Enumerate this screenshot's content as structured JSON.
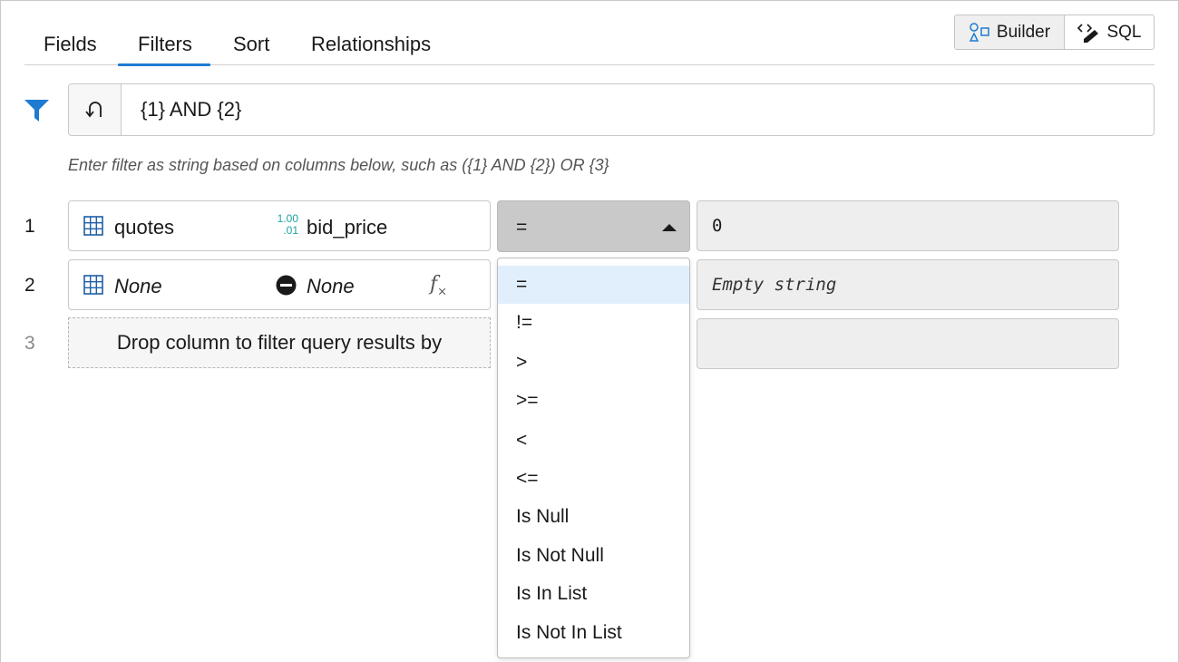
{
  "tabs": [
    {
      "label": "Fields",
      "active": false
    },
    {
      "label": "Filters",
      "active": true
    },
    {
      "label": "Sort",
      "active": false
    },
    {
      "label": "Relationships",
      "active": false
    }
  ],
  "mode_toggle": {
    "builder_label": "Builder",
    "sql_label": "SQL",
    "active": "Builder"
  },
  "filter_expression": {
    "value": "{1} AND {2}",
    "hint": "Enter filter as string based on columns below, such as ({1} AND {2}) OR {3}"
  },
  "rows": [
    {
      "number": "1",
      "table": "quotes",
      "column_type_icon_top": "1.00",
      "column_type_icon_bottom": ".01",
      "column": "bid_price",
      "operator": "=",
      "value": "0"
    },
    {
      "number": "2",
      "table": "None",
      "column": "None",
      "fx_label": "f",
      "fx_sub": "×",
      "value_placeholder": "Empty string"
    },
    {
      "number": "3",
      "drop_text": "Drop column to filter query results by"
    }
  ],
  "operator_menu": {
    "selected": "=",
    "items": [
      "=",
      "!=",
      ">",
      ">=",
      "<",
      "<=",
      "Is Null",
      "Is Not Null",
      "Is In List",
      "Is Not In List"
    ]
  },
  "colors": {
    "accent": "#1e7bd2",
    "numeric_icon": "#1aa3a3",
    "menu_highlight": "#e1effc",
    "select_bg": "#c9c9c9"
  },
  "icons": {
    "filter": "funnel-icon",
    "undo": "undo-icon",
    "table": "table-grid-icon",
    "numeric_column": "numeric-column-icon",
    "none_column": "none-circle-icon",
    "function": "fx-icon",
    "builder": "builder-shapes-icon",
    "sql": "code-edit-icon",
    "dropdown_caret": "caret-up-icon"
  }
}
